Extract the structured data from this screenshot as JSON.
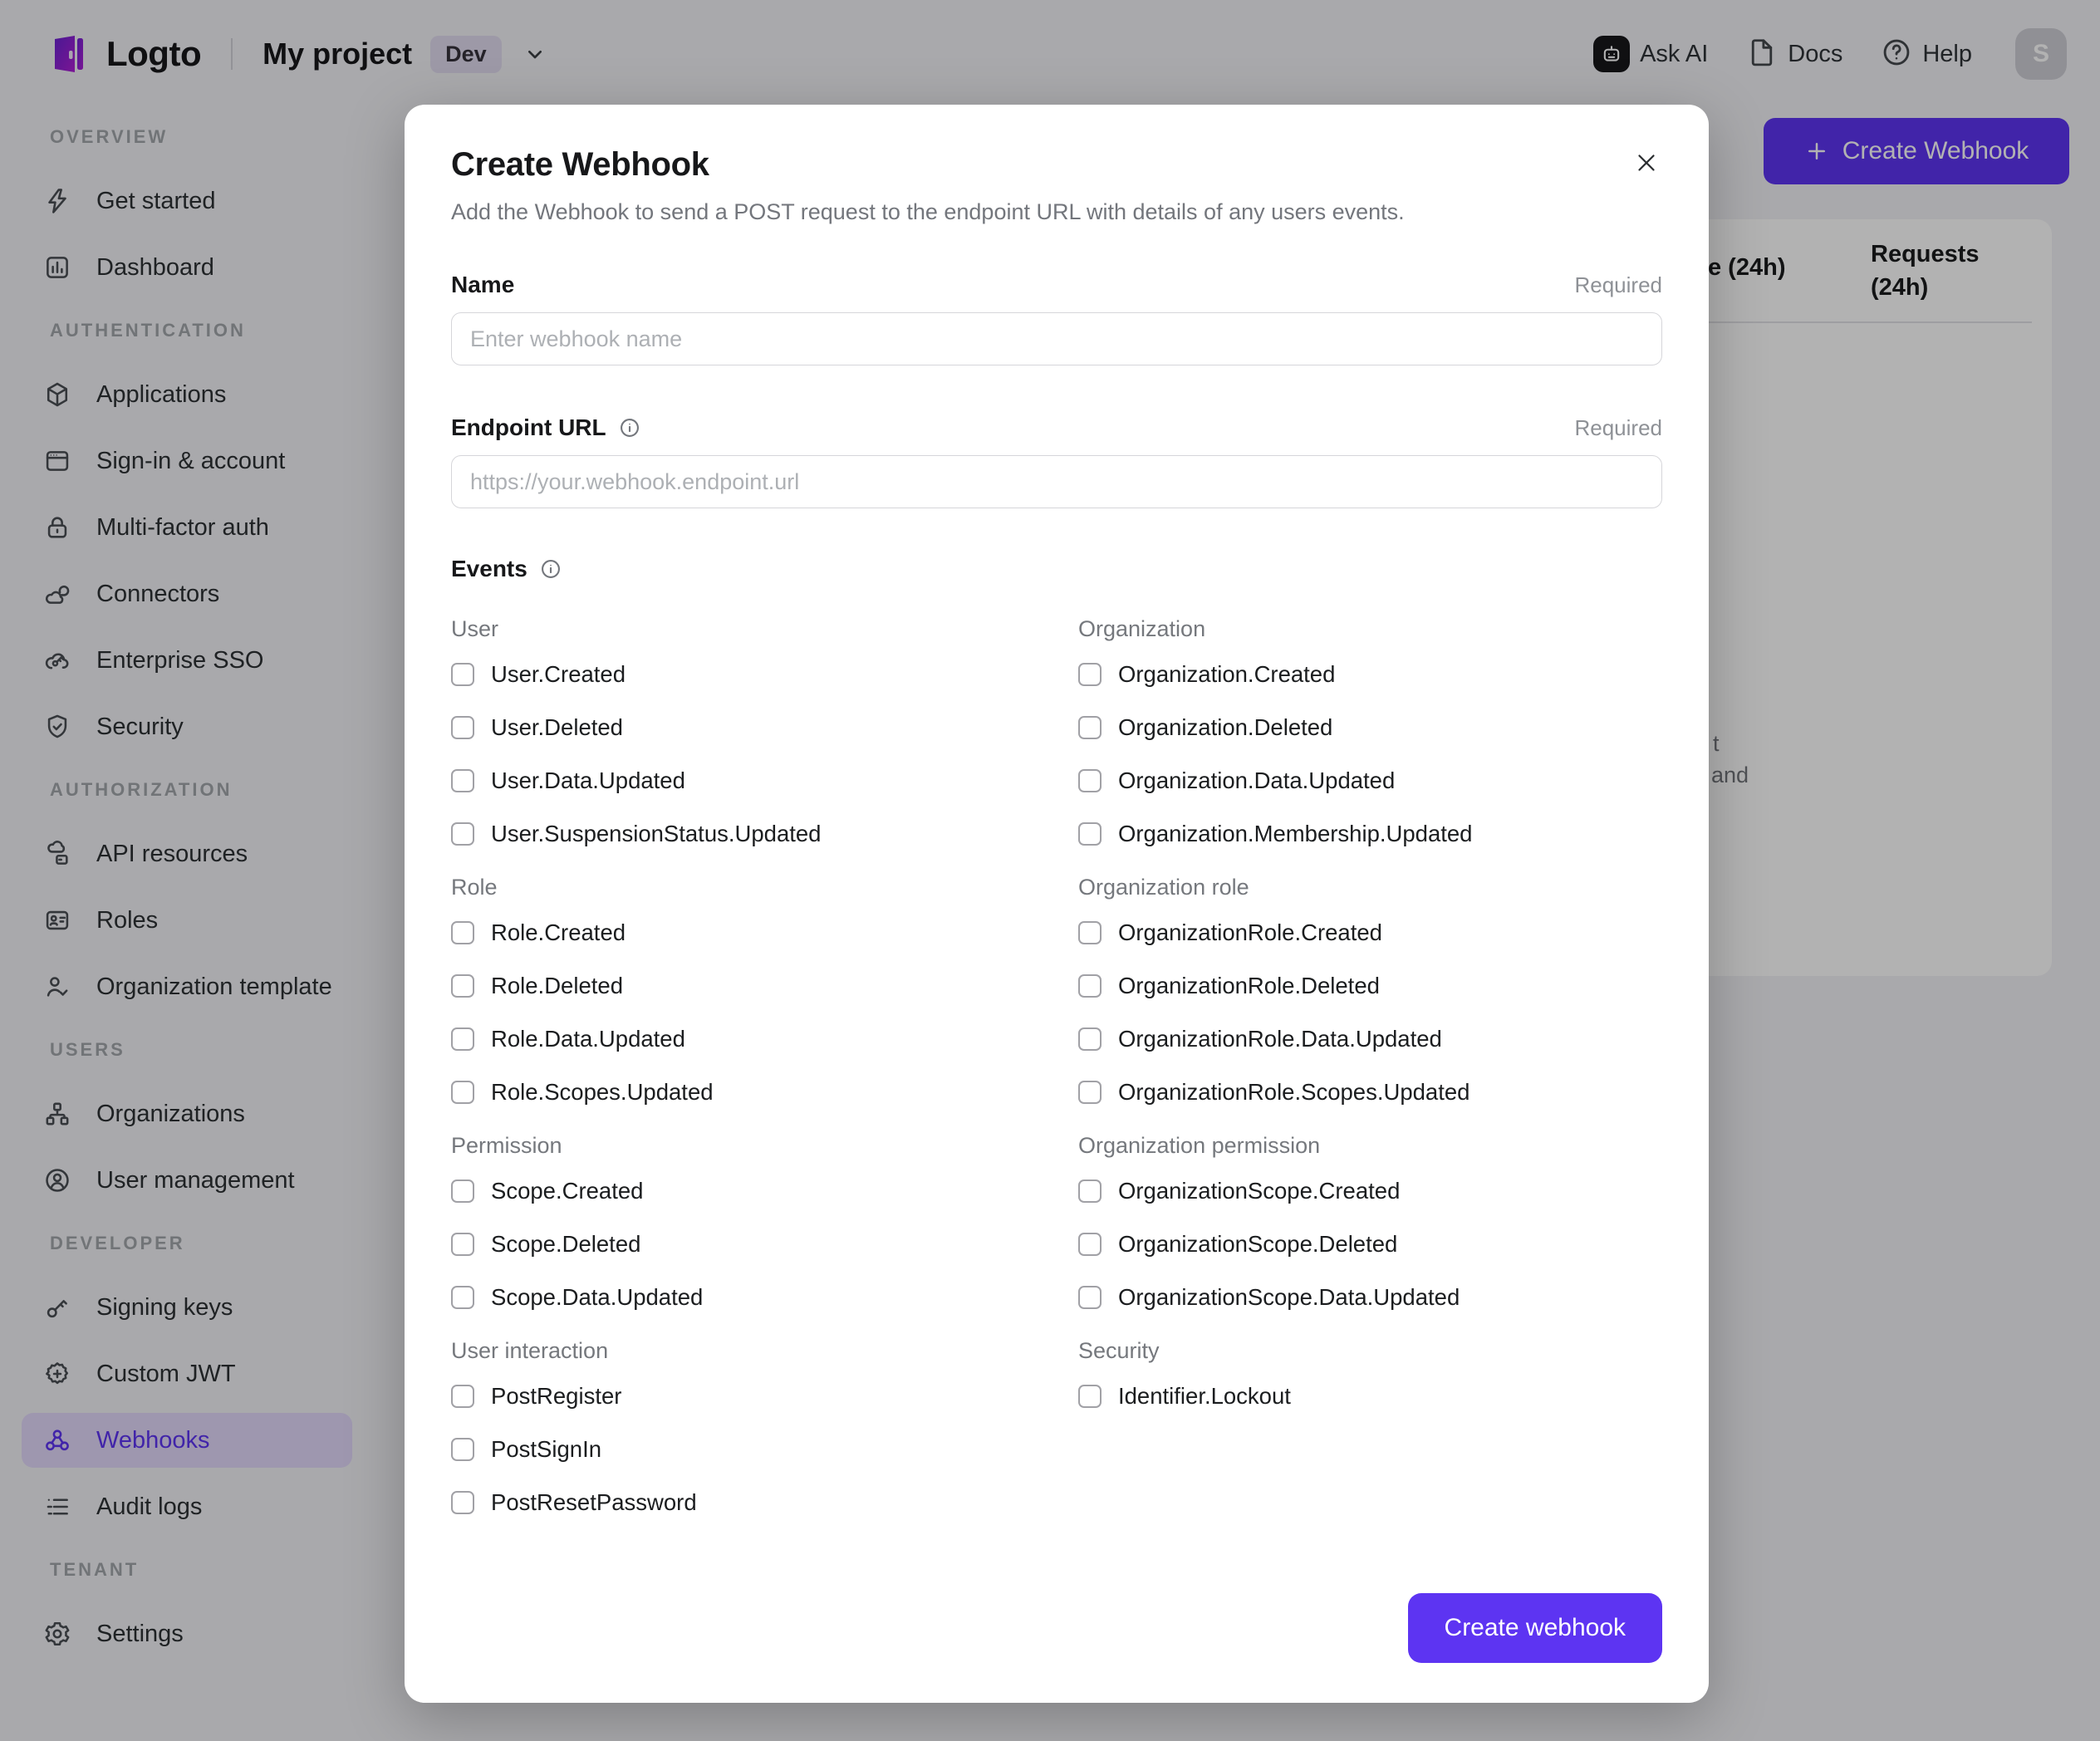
{
  "colors": {
    "accent": "#5d34f2",
    "sidebar_active_bg": "#e2d9fb",
    "env_badge_bg": "#e1dcef",
    "overlay": "rgba(0,0,0,0.30)"
  },
  "topbar": {
    "logo_text": "Logto",
    "project_name": "My project",
    "env_badge": "Dev",
    "actions": [
      {
        "label": "Ask AI",
        "icon": "ask-ai-icon"
      },
      {
        "label": "Docs",
        "icon": "docs-icon"
      },
      {
        "label": "Help",
        "icon": "help-icon"
      }
    ],
    "avatar_initial": "S"
  },
  "sidebar": {
    "sections": [
      {
        "title": "OVERVIEW",
        "items": [
          {
            "label": "Get started",
            "icon": "lightning-icon"
          },
          {
            "label": "Dashboard",
            "icon": "dashboard-icon"
          }
        ]
      },
      {
        "title": "AUTHENTICATION",
        "items": [
          {
            "label": "Applications",
            "icon": "applications-cube-icon"
          },
          {
            "label": "Sign-in & account",
            "icon": "signin-window-icon"
          },
          {
            "label": "Multi-factor auth",
            "icon": "mfa-lock-icon"
          },
          {
            "label": "Connectors",
            "icon": "connectors-icon"
          },
          {
            "label": "Enterprise SSO",
            "icon": "enterprise-sso-icon"
          },
          {
            "label": "Security",
            "icon": "security-shield-icon"
          }
        ]
      },
      {
        "title": "AUTHORIZATION",
        "items": [
          {
            "label": "API resources",
            "icon": "api-resources-icon"
          },
          {
            "label": "Roles",
            "icon": "roles-card-icon"
          },
          {
            "label": "Organization template",
            "icon": "org-template-icon"
          }
        ]
      },
      {
        "title": "USERS",
        "items": [
          {
            "label": "Organizations",
            "icon": "organizations-icon"
          },
          {
            "label": "User management",
            "icon": "user-management-icon"
          }
        ]
      },
      {
        "title": "DEVELOPER",
        "items": [
          {
            "label": "Signing keys",
            "icon": "signing-keys-icon"
          },
          {
            "label": "Custom JWT",
            "icon": "custom-jwt-icon"
          },
          {
            "label": "Webhooks",
            "icon": "webhook-icon",
            "active": true
          },
          {
            "label": "Audit logs",
            "icon": "audit-logs-icon"
          }
        ]
      },
      {
        "title": "TENANT",
        "items": [
          {
            "label": "Settings",
            "icon": "settings-gear-icon"
          }
        ]
      }
    ]
  },
  "background": {
    "create_webhook_button": "Create Webhook",
    "table_header_fragment": "e (24h)",
    "table_header_requests": "Requests (24h)",
    "empty_text_fragments": [
      "t",
      "and"
    ]
  },
  "modal": {
    "title": "Create Webhook",
    "description": "Add the Webhook to send a POST request to the endpoint URL with details of any users events.",
    "required_label": "Required",
    "name_field": {
      "label": "Name",
      "placeholder": "Enter webhook name",
      "value": ""
    },
    "endpoint_field": {
      "label": "Endpoint URL",
      "placeholder": "https://your.webhook.endpoint.url",
      "value": ""
    },
    "events_label": "Events",
    "event_columns": [
      {
        "groups": [
          {
            "title": "User",
            "items": [
              {
                "label": "User.Created",
                "checked": false
              },
              {
                "label": "User.Deleted",
                "checked": false
              },
              {
                "label": "User.Data.Updated",
                "checked": false
              },
              {
                "label": "User.SuspensionStatus.Updated",
                "checked": false
              }
            ]
          },
          {
            "title": "Role",
            "items": [
              {
                "label": "Role.Created",
                "checked": false
              },
              {
                "label": "Role.Deleted",
                "checked": false
              },
              {
                "label": "Role.Data.Updated",
                "checked": false
              },
              {
                "label": "Role.Scopes.Updated",
                "checked": false
              }
            ]
          },
          {
            "title": "Permission",
            "items": [
              {
                "label": "Scope.Created",
                "checked": false
              },
              {
                "label": "Scope.Deleted",
                "checked": false
              },
              {
                "label": "Scope.Data.Updated",
                "checked": false
              }
            ]
          },
          {
            "title": "User interaction",
            "items": [
              {
                "label": "PostRegister",
                "checked": false
              },
              {
                "label": "PostSignIn",
                "checked": false
              },
              {
                "label": "PostResetPassword",
                "checked": false
              }
            ]
          }
        ]
      },
      {
        "groups": [
          {
            "title": "Organization",
            "items": [
              {
                "label": "Organization.Created",
                "checked": false
              },
              {
                "label": "Organization.Deleted",
                "checked": false
              },
              {
                "label": "Organization.Data.Updated",
                "checked": false
              },
              {
                "label": "Organization.Membership.Updated",
                "checked": false
              }
            ]
          },
          {
            "title": "Organization role",
            "items": [
              {
                "label": "OrganizationRole.Created",
                "checked": false
              },
              {
                "label": "OrganizationRole.Deleted",
                "checked": false
              },
              {
                "label": "OrganizationRole.Data.Updated",
                "checked": false
              },
              {
                "label": "OrganizationRole.Scopes.Updated",
                "checked": false
              }
            ]
          },
          {
            "title": "Organization permission",
            "items": [
              {
                "label": "OrganizationScope.Created",
                "checked": false
              },
              {
                "label": "OrganizationScope.Deleted",
                "checked": false
              },
              {
                "label": "OrganizationScope.Data.Updated",
                "checked": false
              }
            ]
          },
          {
            "title": "Security",
            "items": [
              {
                "label": "Identifier.Lockout",
                "checked": false
              }
            ]
          }
        ]
      }
    ],
    "submit_label": "Create webhook"
  }
}
